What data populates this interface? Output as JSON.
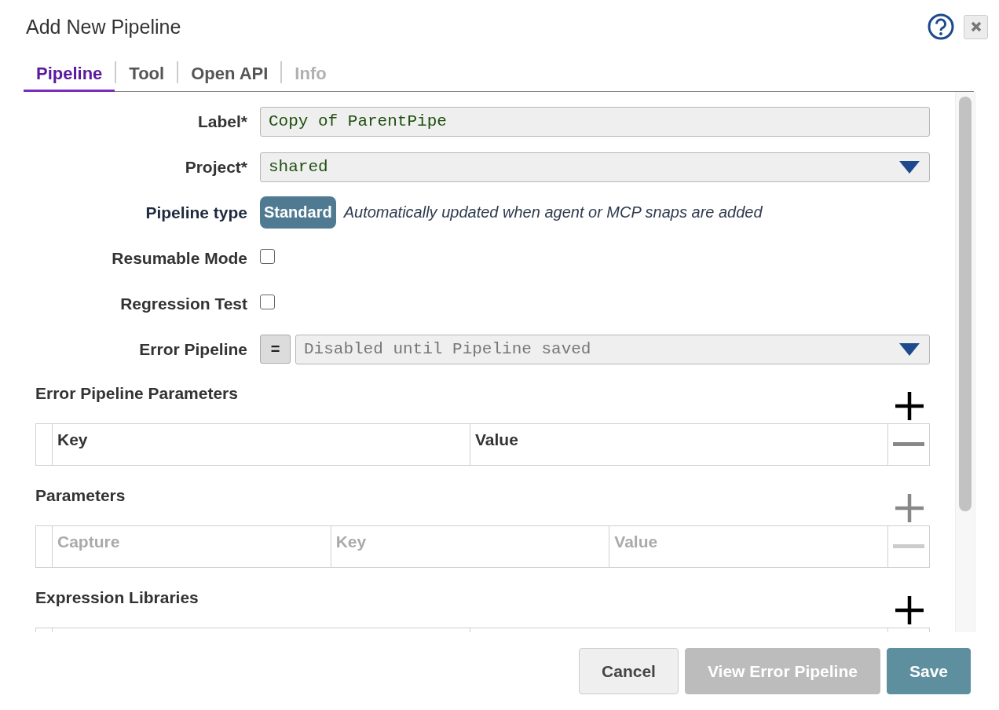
{
  "dialog": {
    "title": "Add New Pipeline"
  },
  "tabs": [
    {
      "label": "Pipeline",
      "selected": true,
      "disabled": false
    },
    {
      "label": "Tool",
      "selected": false,
      "disabled": false
    },
    {
      "label": "Open API",
      "selected": false,
      "disabled": false
    },
    {
      "label": "Info",
      "selected": false,
      "disabled": true
    }
  ],
  "fields": [
    {
      "kind": "text",
      "label": "Label*",
      "value": "Copy of ParentPipe"
    },
    {
      "kind": "select",
      "label": "Project*",
      "value": "shared"
    },
    {
      "kind": "badge",
      "label": "Pipeline type",
      "value": "Standard",
      "note": "Automatically updated when agent or MCP snaps are added"
    },
    {
      "kind": "checkbox",
      "label": "Resumable Mode",
      "checked": false
    },
    {
      "kind": "checkbox",
      "label": "Regression Test",
      "checked": false
    },
    {
      "kind": "expression_select",
      "label": "Error Pipeline",
      "toggle": "=",
      "placeholder": "Disabled until Pipeline saved"
    }
  ],
  "sections": [
    {
      "title": "Error Pipeline Parameters",
      "disabled": false,
      "columns": [
        "Key",
        "Value"
      ]
    },
    {
      "title": "Parameters",
      "disabled": true,
      "columns": [
        "Capture",
        "Key",
        "Value"
      ]
    },
    {
      "title": "Expression Libraries",
      "disabled": false
    }
  ],
  "buttons": [
    {
      "label": "Cancel",
      "kind": "secondary"
    },
    {
      "label": "View Error Pipeline",
      "kind": "disabled"
    },
    {
      "label": "Save",
      "kind": "primary"
    }
  ]
}
